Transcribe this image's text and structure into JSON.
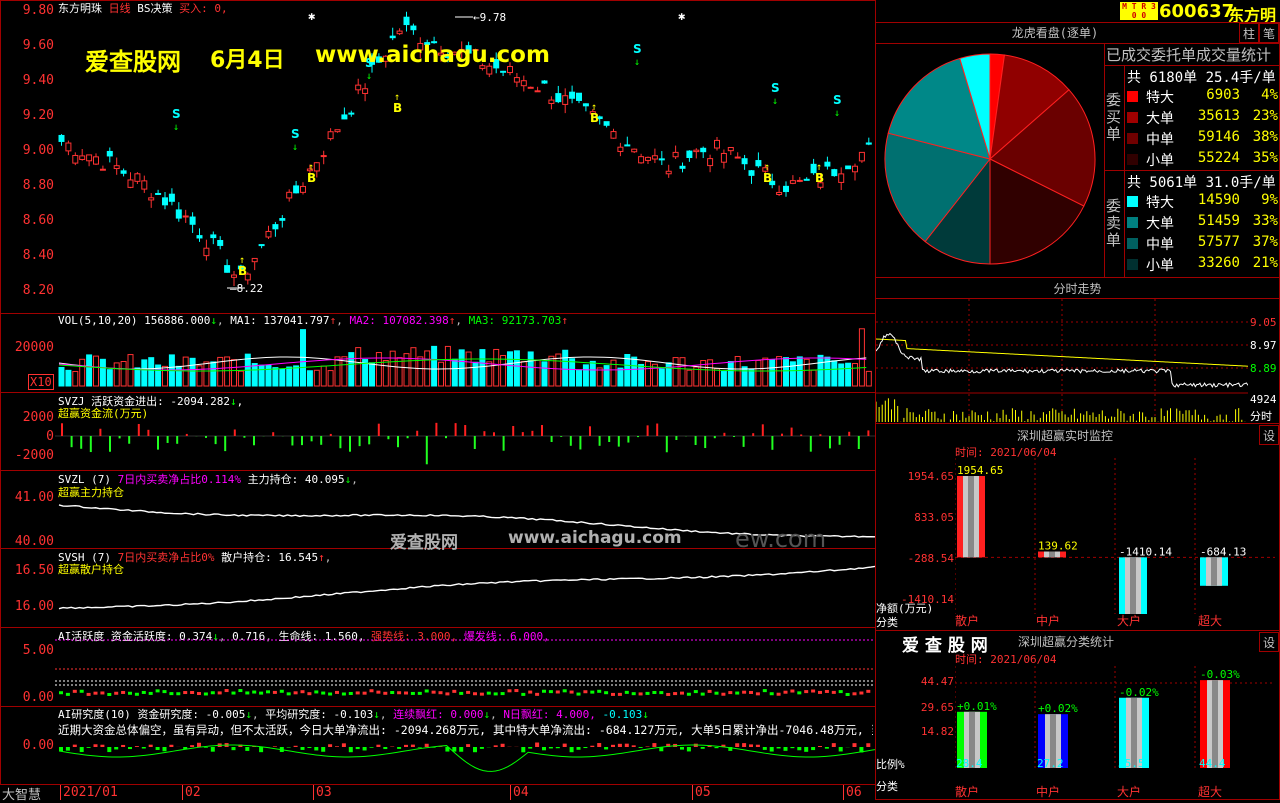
{
  "header": {
    "app_name": "东方明珠",
    "period": "日线",
    "strategy": "BS决策",
    "buy_signal": "买入: 0,",
    "brand_badge": "M T R 3 0 0",
    "stock_code": "600637",
    "stock_name": "东方明"
  },
  "watermark": {
    "site": "爱查股网",
    "date": "6月4日",
    "url": "www.aichagu.com",
    "mid_text": "爱查股网",
    "mid_url": "www.aichagu.com",
    "mid_tail": "ew.com"
  },
  "main_chart": {
    "price_axis": [
      "9.80",
      "9.60",
      "9.40",
      "9.20",
      "9.00",
      "8.80",
      "8.60",
      "8.40",
      "8.20"
    ],
    "high_label": "9.78",
    "low_label": "8.22"
  },
  "vol_panel": {
    "title": "VOL(5,10,20)",
    "vol": "156886.000",
    "ma1": "MA1: 137041.797",
    "ma2": "MA2: 107082.398",
    "ma3": "MA3: 92173.703",
    "axis": [
      "20000"
    ],
    "unit": "X10"
  },
  "svzj_panel": {
    "title": "SVZJ  活跃资金进出: -2094.282",
    "subtitle": "超赢资金流(万元)",
    "axis": [
      "2000",
      "0",
      "-2000"
    ]
  },
  "svzl_panel": {
    "title": "SVZL (7)",
    "desc": "7日内买卖净占比0.114%",
    "hold": "主力持仓: 40.095",
    "subtitle": "超赢主力持仓",
    "axis": [
      "41.00",
      "40.00"
    ]
  },
  "svsh_panel": {
    "title": "SVSH (7)",
    "desc": "7日内买卖净占比0%",
    "hold": "散户持仓: 16.545",
    "subtitle": "超赢散户持仓",
    "axis": [
      "16.50",
      "16.00"
    ]
  },
  "ai_panel": {
    "title": "AI活跃度 资金活跃度: 0.374",
    "v2": "0.716",
    "life": "生命线: 1.560,",
    "strong": "强势线: 3.000,",
    "burst": "爆发线: 6.000,",
    "axis": [
      "5.00",
      "0.00"
    ]
  },
  "research_panel": {
    "title": "AI研究度(10) 资金研究度: -0.005",
    "avg": "平均研究度: -0.103",
    "lianxu": "连续飘红: 0.000",
    "nred": "N日飘红: 4.000,",
    "last": "-0.103",
    "note": "近期大资金总体偏空，虽有异动，但不太活跃，今日大单净流出: -2094.268万元, 其中特大单净流出: -684.127万元, 大单5日累计净出-7046.48万元, 当日",
    "axis": [
      "0.00"
    ]
  },
  "bottom_axis": {
    "left_label": "大智慧",
    "dates": [
      "2021/01",
      "02",
      "03",
      "04",
      "05",
      "06"
    ]
  },
  "dragon_panel": {
    "title": "龙虎看盘(逐单)",
    "btn_zhu": "柱",
    "btn_bi": "笔",
    "stats_title": "已成交委托单成交量统计",
    "buy_side_label": "委买单",
    "sell_side_label": "委卖单",
    "buy_total": "共 6180单 25.4手/单",
    "sell_total": "共 5061单 31.0手/单",
    "buy_rows": [
      {
        "name": "特大",
        "value": "6903",
        "pct": "4%",
        "color": "#ff0000"
      },
      {
        "name": "大单",
        "value": "35613",
        "pct": "23%",
        "color": "#a00000"
      },
      {
        "name": "中单",
        "value": "59146",
        "pct": "38%",
        "color": "#700000"
      },
      {
        "name": "小单",
        "value": "55224",
        "pct": "35%",
        "color": "#300000"
      }
    ],
    "sell_rows": [
      {
        "name": "特大",
        "value": "14590",
        "pct": "9%",
        "color": "#00ffff"
      },
      {
        "name": "大单",
        "value": "51459",
        "pct": "33%",
        "color": "#008080"
      },
      {
        "name": "中单",
        "value": "57577",
        "pct": "37%",
        "color": "#006060"
      },
      {
        "name": "小单",
        "value": "33260",
        "pct": "21%",
        "color": "#003030"
      }
    ],
    "pie": [
      {
        "value": 6903,
        "color": "#ff0000"
      },
      {
        "value": 35613,
        "color": "#900000"
      },
      {
        "value": 59146,
        "color": "#6a0000"
      },
      {
        "value": 55224,
        "color": "#300000"
      },
      {
        "value": 33260,
        "color": "#003a3a"
      },
      {
        "value": 57577,
        "color": "#007070"
      },
      {
        "value": 51459,
        "color": "#008888"
      },
      {
        "value": 14590,
        "color": "#00ffff"
      }
    ]
  },
  "intraday_panel": {
    "title": "分时走势",
    "axis": [
      "9.05",
      "8.97",
      "8.89"
    ],
    "vol_label": "4924",
    "time_label": "分时"
  },
  "monitor_panel": {
    "title": "深圳超赢实时监控",
    "btn": "设",
    "time_label": "时间: 2021/06/04",
    "axis": [
      "1954.65",
      "833.05",
      "-288.54",
      "-1410.14"
    ],
    "y_unit": "净额(万元)",
    "x_unit": "分类",
    "categories": [
      "散户",
      "中户",
      "大户",
      "超大"
    ],
    "values": [
      1954.65,
      139.62,
      -1410.14,
      -684.13
    ],
    "labels": [
      "1954.65",
      "139.62",
      "-1410.14",
      "-684.13"
    ],
    "colors": [
      "#ff2020",
      "#ff2020",
      "#00ffff",
      "#00ffff"
    ]
  },
  "class_panel": {
    "brand": "爱 查 股 网",
    "title": "深圳超赢分类统计",
    "btn": "设",
    "time_label": "时间: 2021/06/04",
    "axis": [
      "44.47",
      "29.65",
      "14.82"
    ],
    "y_unit": "比例%",
    "x_unit": "分类",
    "categories": [
      "散户",
      "中户",
      "大户",
      "超大"
    ],
    "values": [
      28.4,
      27.2,
      35.5,
      44.4
    ],
    "labels": [
      "28.4",
      "27.2",
      "35.5",
      "44.4"
    ],
    "delta": [
      "+0.01%",
      "+0.02%",
      "-0.02%",
      "-0.03%"
    ],
    "colors": [
      "#00ff00",
      "#0000ff",
      "#00ffff",
      "#ff0000"
    ]
  }
}
